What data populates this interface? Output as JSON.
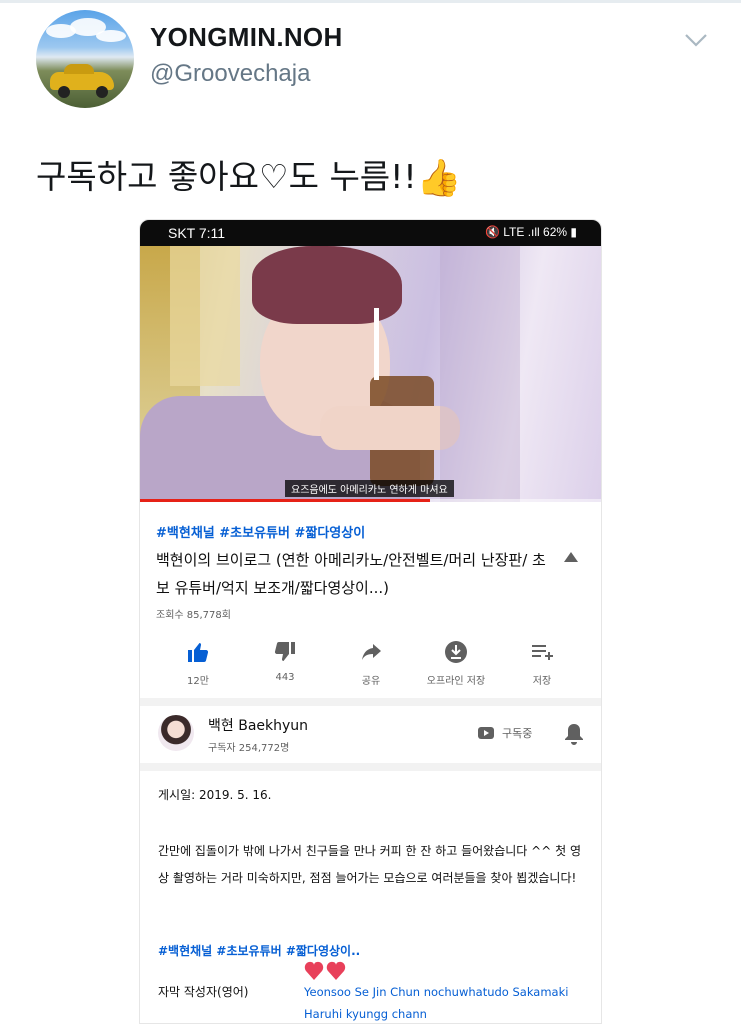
{
  "tweet": {
    "display_name": "YONGMIN.NOH",
    "handle": "@Groovechaja",
    "text": "구독하고 좋아요♡도 누름!!",
    "emoji": "👍"
  },
  "embedded_screenshot": {
    "status_bar": {
      "carrier_time": "SKT 7:11",
      "right": "🔇 LTE .ıll 62% ▮"
    },
    "video": {
      "caption": "요즈음에도 아메리카노 연하게 마셔요",
      "progress_fraction": 0.63
    },
    "hashtags": "#백현채널 #초보유튜버 #짧다영상이",
    "title": "백현이의 브이로그 (연한 아메리카노/안전벨트/머리 난장판/ 초보 유튜버/억지 보조개/짧다영상이...)",
    "views": "조회수 85,778회",
    "actions": [
      {
        "icon": "thumbs-up-icon",
        "label": "12만"
      },
      {
        "icon": "thumbs-down-icon",
        "label": "443"
      },
      {
        "icon": "share-icon",
        "label": "공유"
      },
      {
        "icon": "download-icon",
        "label": "오프라인 저장"
      },
      {
        "icon": "add-to-playlist-icon",
        "label": "저장"
      }
    ],
    "channel": {
      "name": "백현 Baekhyun",
      "subscribers": "구독자 254,772명",
      "subscribed_label": "구독중"
    },
    "description": {
      "posted": "게시일: 2019. 5. 16.",
      "body": "간만에 집돌이가 밖에 나가서 친구들을 만나 커피 한 잔 하고 들어왔습니다 ^^ 첫 영상 촬영하는 거라 미숙하지만, 점점 늘어가는 모습으로 여러분들을 찾아 뵙겠습니다!",
      "hashtags": "#백현채널 #초보유튜버 #짧다영상이..",
      "subtitle_label": "자막 작성자(영어)",
      "subtitle_credits": "Yeonsoo  Se Jin Chun  nochuwhatudo  Sakamaki Haruhi  kyungg chann"
    },
    "colors": {
      "link_blue": "#065fd4",
      "like_blue": "#065fd4",
      "progress_red": "#e62117",
      "heart_red": "#e8405a"
    }
  }
}
